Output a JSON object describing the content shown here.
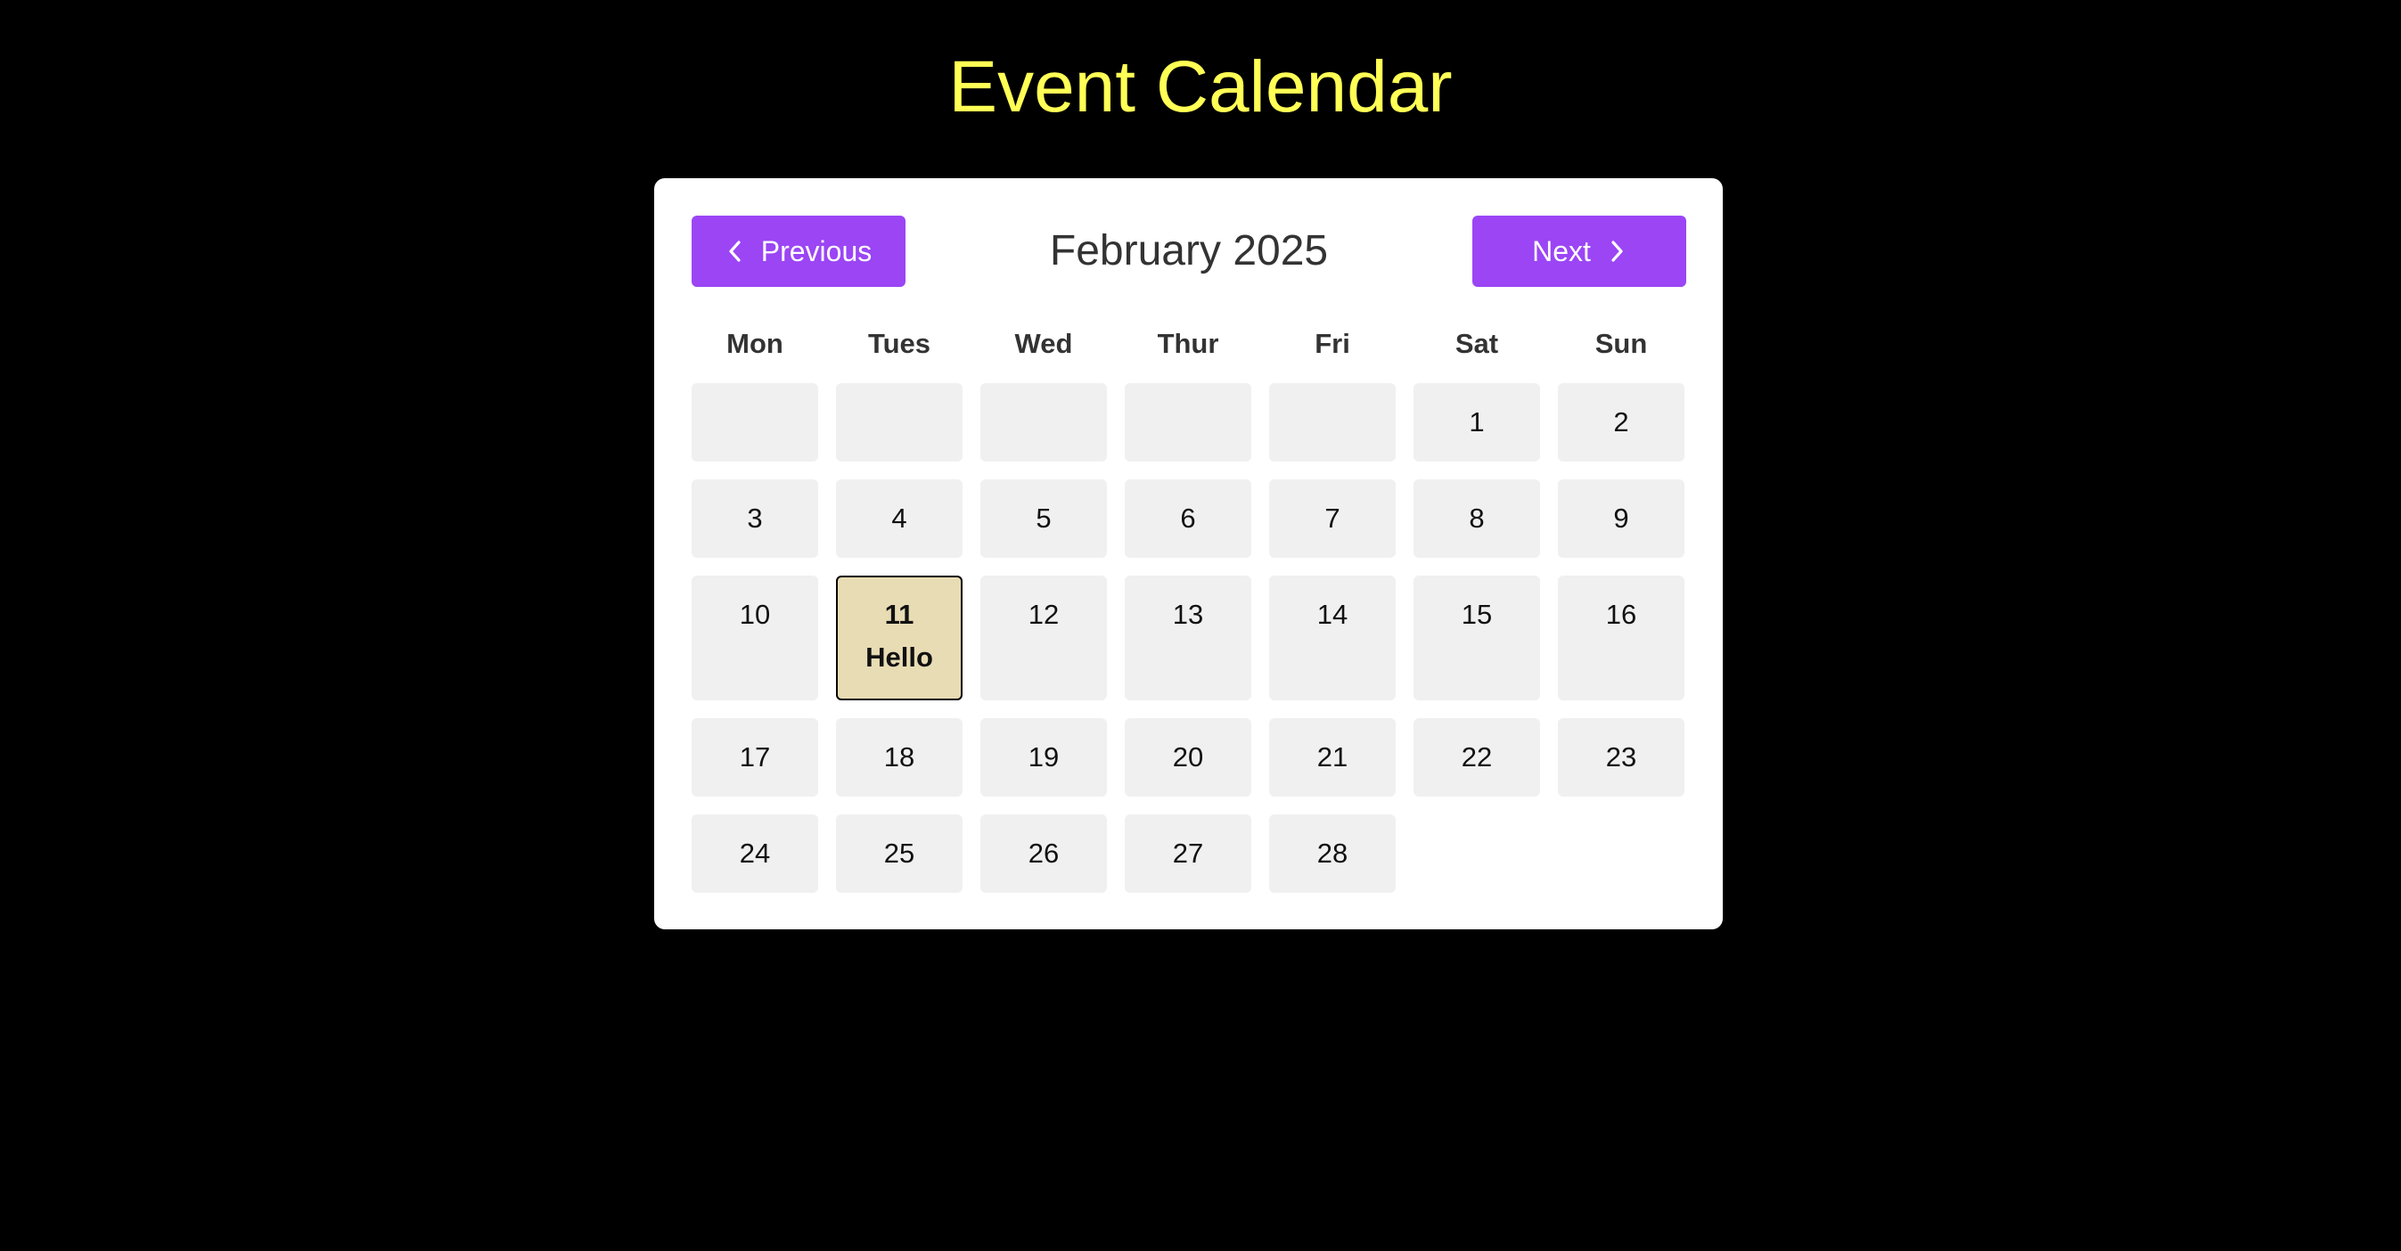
{
  "page": {
    "title": "Event Calendar",
    "title_color": "#ffff55",
    "background_color": "#000000"
  },
  "calendar": {
    "month_label": "February 2025",
    "accent_color": "#9b45f5",
    "previous_label": "Previous",
    "next_label": "Next",
    "previous_icon": "chevron-left-icon",
    "next_icon": "chevron-right-icon",
    "weekdays": [
      "Mon",
      "Tues",
      "Wed",
      "Thur",
      "Fri",
      "Sat",
      "Sun"
    ],
    "leading_blank_days": 5,
    "trailing_blank_days": 2,
    "days": [
      {
        "day": "1"
      },
      {
        "day": "2"
      },
      {
        "day": "3"
      },
      {
        "day": "4"
      },
      {
        "day": "5"
      },
      {
        "day": "6"
      },
      {
        "day": "7"
      },
      {
        "day": "8"
      },
      {
        "day": "9"
      },
      {
        "day": "10"
      },
      {
        "day": "11",
        "event": "Hello"
      },
      {
        "day": "12"
      },
      {
        "day": "13"
      },
      {
        "day": "14"
      },
      {
        "day": "15"
      },
      {
        "day": "16"
      },
      {
        "day": "17"
      },
      {
        "day": "18"
      },
      {
        "day": "19"
      },
      {
        "day": "20"
      },
      {
        "day": "21"
      },
      {
        "day": "22"
      },
      {
        "day": "23"
      },
      {
        "day": "24"
      },
      {
        "day": "25"
      },
      {
        "day": "26"
      },
      {
        "day": "27"
      },
      {
        "day": "28"
      }
    ],
    "event_day_color": "#e8dcb4",
    "empty_cell_color": "#f0f0f0"
  }
}
